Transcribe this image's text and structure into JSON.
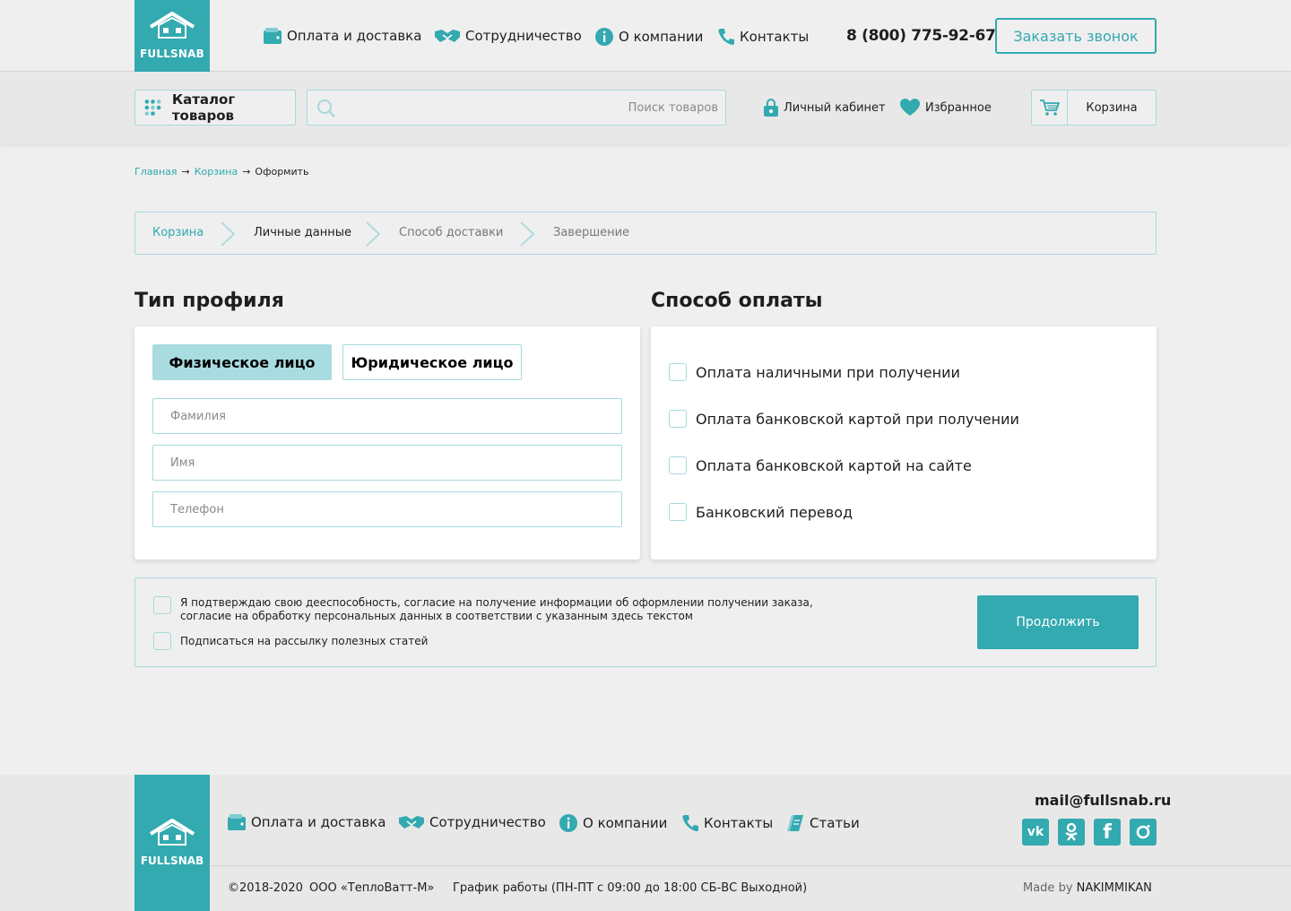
{
  "colors": {
    "accent": "#33a9b0",
    "accent_light": "#a8dce0",
    "border": "#a8d9dc"
  },
  "logo": {
    "text": "FULLSNAB"
  },
  "nav": {
    "items": [
      {
        "label": "Оплата и доставка",
        "icon": "wallet-icon"
      },
      {
        "label": "Сотрудничество",
        "icon": "handshake-icon"
      },
      {
        "label": "О компании",
        "icon": "info-icon"
      },
      {
        "label": "Контакты",
        "icon": "phone-icon"
      }
    ]
  },
  "header": {
    "phone": "8 (800) 775-92-67",
    "callback_label": "Заказать звонок",
    "catalog_label": "Каталог товаров",
    "search_placeholder": "Поиск товаров",
    "cabinet_label": "Личный кабинет",
    "favorites_label": "Избранное",
    "cart_label": "Корзина"
  },
  "breadcrumb": {
    "home": "Главная",
    "cart": "Корзина",
    "current": "Оформить",
    "separator": "→"
  },
  "steps": [
    {
      "label": "Корзина",
      "state": "done"
    },
    {
      "label": "Личные данные",
      "state": "active"
    },
    {
      "label": "Способ доставки",
      "state": "pending"
    },
    {
      "label": "Завершение",
      "state": "pending"
    }
  ],
  "profile": {
    "title": "Тип профиля",
    "type_individual": "Физическое лицо",
    "type_legal": "Юридическое лицо",
    "fields": {
      "lastname_placeholder": "Фамилия",
      "firstname_placeholder": "Имя",
      "phone_placeholder": "Телефон"
    }
  },
  "payment": {
    "title": "Способ оплаты",
    "options": [
      "Оплата наличными при получении",
      "Оплата банковской картой при получении",
      "Оплата банковской картой на сайте",
      "Банковский перевод"
    ]
  },
  "consent": {
    "line1": "Я подтверждаю свою дееспособность, согласие на получение информации об оформлении получении заказа,",
    "line2": "согласие на обработку персональных данных в соответствии с указанным здесь текстом",
    "subscribe": "Подписаться на рассылку полезных статей",
    "continue_label": "Продолжить"
  },
  "footer": {
    "nav": [
      {
        "label": "Оплата и доставка",
        "icon": "wallet-icon"
      },
      {
        "label": "Сотрудничество",
        "icon": "handshake-icon"
      },
      {
        "label": "О компании",
        "icon": "info-icon"
      },
      {
        "label": "Контакты",
        "icon": "phone-icon"
      },
      {
        "label": "Статьи",
        "icon": "articles-icon"
      }
    ],
    "email": "mail@fullsnab.ru",
    "social": [
      "vk-icon",
      "odnoklassniki-icon",
      "facebook-icon",
      "instagram-icon"
    ],
    "copyright": "©2018-2020",
    "company": "ООО «ТеплоВатт-М»",
    "schedule": "График работы (ПН-ПТ с 09:00 до 18:00 СБ-ВС Выходной)",
    "made_by_prefix": "Made by",
    "made_by_name": "NAKIMMIKAN"
  }
}
